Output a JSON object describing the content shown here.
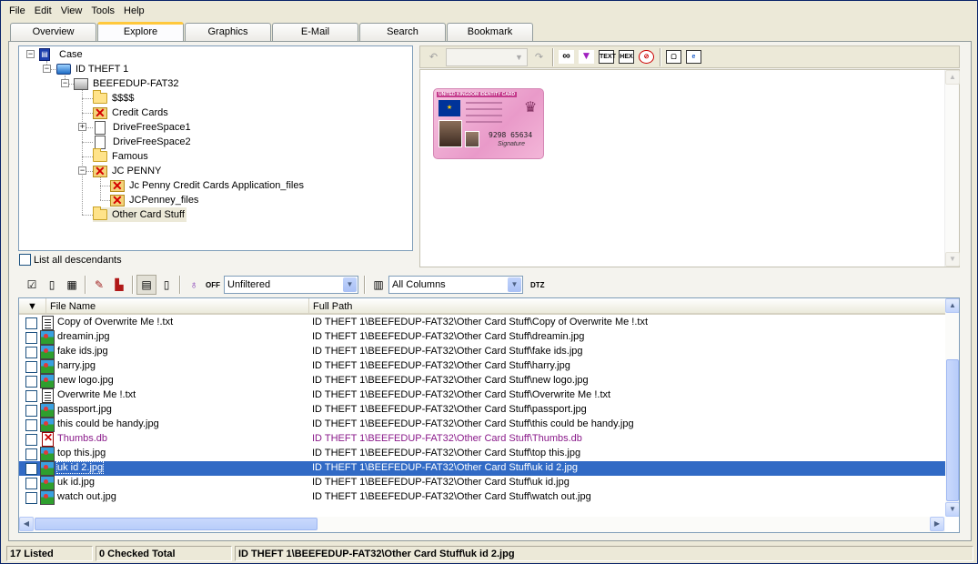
{
  "menu": [
    "File",
    "Edit",
    "View",
    "Tools",
    "Help"
  ],
  "tabs": [
    "Overview",
    "Explore",
    "Graphics",
    "E-Mail",
    "Search",
    "Bookmark"
  ],
  "active_tab": "Explore",
  "tree": {
    "items": [
      {
        "label": "Case",
        "icon": "case-icon"
      },
      {
        "label": "ID THEFT 1",
        "icon": "drive-icon"
      },
      {
        "label": "BEEFEDUP-FAT32",
        "icon": "disk-icon"
      },
      {
        "label": "$$$$",
        "icon": "folder-icon"
      },
      {
        "label": "Credit Cards",
        "icon": "deleted-folder-icon"
      },
      {
        "label": "DriveFreeSpace1",
        "icon": "file-icon"
      },
      {
        "label": "DriveFreeSpace2",
        "icon": "file-icon"
      },
      {
        "label": "Famous",
        "icon": "folder-icon"
      },
      {
        "label": "JC PENNY",
        "icon": "deleted-folder-icon"
      },
      {
        "label": "Jc Penny Credit Cards Application_files",
        "icon": "deleted-folder-icon"
      },
      {
        "label": "JCPenney_files",
        "icon": "deleted-folder-icon"
      },
      {
        "label": "Other Card Stuff",
        "icon": "folder-icon"
      }
    ],
    "list_all_label": "List all descendants"
  },
  "viewer": {
    "card_title": "UNITED KINGDOM IDENTITY CARD",
    "card_number": "9298 65634",
    "card_signature": "Signature"
  },
  "list_toolbar": {
    "off_label": "OFF",
    "filter_value": "Unfiltered",
    "columns_value": "All Columns",
    "dtz_label": "DTZ"
  },
  "table": {
    "headers": [
      "File Name",
      "Full Path"
    ],
    "rows": [
      {
        "name": "Copy of Overwrite Me !.txt",
        "path": "ID THEFT 1\\BEEFEDUP-FAT32\\Other Card Stuff\\Copy of Overwrite Me !.txt",
        "icon": "text-file-icon"
      },
      {
        "name": "dreamin.jpg",
        "path": "ID THEFT 1\\BEEFEDUP-FAT32\\Other Card Stuff\\dreamin.jpg",
        "icon": "image-file-icon"
      },
      {
        "name": "fake ids.jpg",
        "path": "ID THEFT 1\\BEEFEDUP-FAT32\\Other Card Stuff\\fake ids.jpg",
        "icon": "image-file-icon"
      },
      {
        "name": "harry.jpg",
        "path": "ID THEFT 1\\BEEFEDUP-FAT32\\Other Card Stuff\\harry.jpg",
        "icon": "image-file-icon"
      },
      {
        "name": "new logo.jpg",
        "path": "ID THEFT 1\\BEEFEDUP-FAT32\\Other Card Stuff\\new logo.jpg",
        "icon": "image-file-icon"
      },
      {
        "name": "Overwrite Me !.txt",
        "path": "ID THEFT 1\\BEEFEDUP-FAT32\\Other Card Stuff\\Overwrite Me !.txt",
        "icon": "text-file-icon"
      },
      {
        "name": "passport.jpg",
        "path": "ID THEFT 1\\BEEFEDUP-FAT32\\Other Card Stuff\\passport.jpg",
        "icon": "image-file-icon"
      },
      {
        "name": "this could be handy.jpg",
        "path": "ID THEFT 1\\BEEFEDUP-FAT32\\Other Card Stuff\\this could be handy.jpg",
        "icon": "image-file-icon"
      },
      {
        "name": "Thumbs.db",
        "path": "ID THEFT 1\\BEEFEDUP-FAT32\\Other Card Stuff\\Thumbs.db",
        "icon": "deleted-file-icon"
      },
      {
        "name": "top this.jpg",
        "path": "ID THEFT 1\\BEEFEDUP-FAT32\\Other Card Stuff\\top this.jpg",
        "icon": "image-file-icon"
      },
      {
        "name": "uk id 2.jpg",
        "path": "ID THEFT 1\\BEEFEDUP-FAT32\\Other Card Stuff\\uk id 2.jpg",
        "icon": "image-file-icon"
      },
      {
        "name": "uk id.jpg",
        "path": "ID THEFT 1\\BEEFEDUP-FAT32\\Other Card Stuff\\uk id.jpg",
        "icon": "image-file-icon"
      },
      {
        "name": "watch out.jpg",
        "path": "ID THEFT 1\\BEEFEDUP-FAT32\\Other Card Stuff\\watch out.jpg",
        "icon": "image-file-icon"
      }
    ],
    "selected_row": "uk id 2.jpg"
  },
  "status": {
    "listed": "17 Listed",
    "checked": "0 Checked Total",
    "path": "ID THEFT 1\\BEEFEDUP-FAT32\\Other Card Stuff\\uk id 2.jpg"
  },
  "colors": {
    "selection": "#316ac5",
    "deleted_text": "#8a1a8a",
    "tab_highlight": "#ffc83c"
  }
}
